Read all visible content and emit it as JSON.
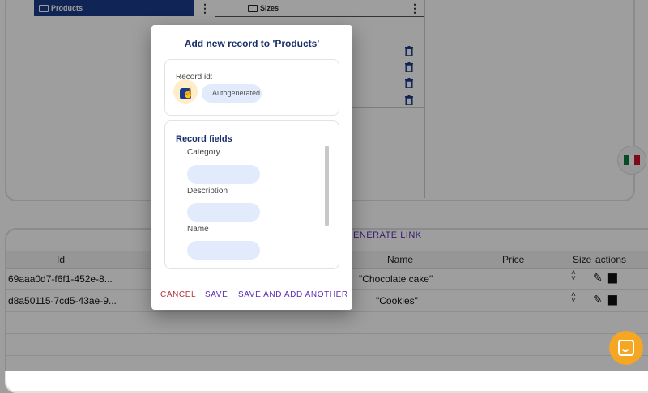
{
  "background": {
    "tree": {
      "products_label": "Products",
      "sizes_label": "Sizes"
    },
    "generate_link": "ENERATE LINK",
    "table": {
      "headers": [
        "Id",
        "Name",
        "Price",
        "Size",
        "actions"
      ],
      "rows": [
        {
          "id": "69aaa0d7-f6f1-452e-8...",
          "name": "\"Chocolate cake\""
        },
        {
          "id": "d8a50115-7cd5-43ae-9...",
          "name": "\"Cookies\""
        }
      ]
    },
    "colors": {
      "accent": "#1a3a8a",
      "link": "#5a2bb5",
      "chat": "#f5a623"
    }
  },
  "dialog": {
    "title": "Add new record to 'Products'",
    "record_id": {
      "label": "Record id:",
      "placeholder": "Autogenerated"
    },
    "fields": {
      "title": "Record fields",
      "items": [
        {
          "label": "Category",
          "value": ""
        },
        {
          "label": "Description",
          "value": ""
        },
        {
          "label": "Name",
          "value": ""
        }
      ]
    },
    "buttons": {
      "cancel": "CANCEL",
      "save": "SAVE",
      "save_add": "SAVE AND ADD ANOTHER"
    },
    "colors": {
      "title": "#1a2f6b",
      "cancel": "#b5323a",
      "save": "#5a2bb5",
      "input_bg": "#e2ebfb"
    }
  }
}
